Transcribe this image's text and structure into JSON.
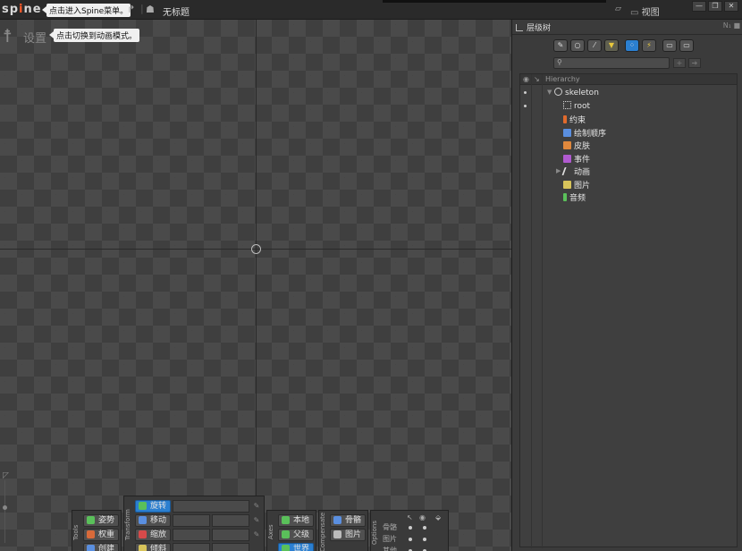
{
  "app": {
    "logo_text": "sp",
    "logo_accent": "i",
    "logo_rest": "ne",
    "menu_tip": "点击进入Spine菜单。",
    "doc_title": "无标题",
    "view_menu": "视图"
  },
  "viewport": {
    "mode_label": "设置",
    "mode_tip": "点击切换到动画模式。"
  },
  "tools": {
    "label": "Tools",
    "items": [
      "姿势",
      "权重",
      "创建"
    ]
  },
  "transform": {
    "label": "Transform",
    "items": [
      "旋转",
      "移动",
      "缩放",
      "倾斜"
    ]
  },
  "axes": {
    "label": "Axes",
    "items": [
      "本地",
      "父级",
      "世界"
    ]
  },
  "compensate": {
    "label": "Compensate",
    "items": [
      "骨骼",
      "图片"
    ]
  },
  "options": {
    "label": "Options",
    "rows": [
      "骨骼",
      "图片",
      "其他"
    ]
  },
  "hierarchy_panel": {
    "tab_label": "层级树",
    "tab_right": "N̲",
    "column_header": "Hierarchy",
    "search_placeholder": "",
    "nodes": [
      {
        "label": "skeleton",
        "color": "#cccccc"
      },
      {
        "label": "root",
        "color": "#dddddd"
      },
      {
        "label": "约束",
        "color": "#e06a2c"
      },
      {
        "label": "绘制顺序",
        "color": "#5a8fe0"
      },
      {
        "label": "皮肤",
        "color": "#e0883c"
      },
      {
        "label": "事件",
        "color": "#b05ad0"
      },
      {
        "label": "动画",
        "color": "#dddddd"
      },
      {
        "label": "图片",
        "color": "#d8c45a"
      },
      {
        "label": "音频",
        "color": "#5ac05a"
      }
    ]
  },
  "colors": {
    "accent_blue": "#2b7fd0",
    "logo_accent": "#ff5a2a"
  }
}
